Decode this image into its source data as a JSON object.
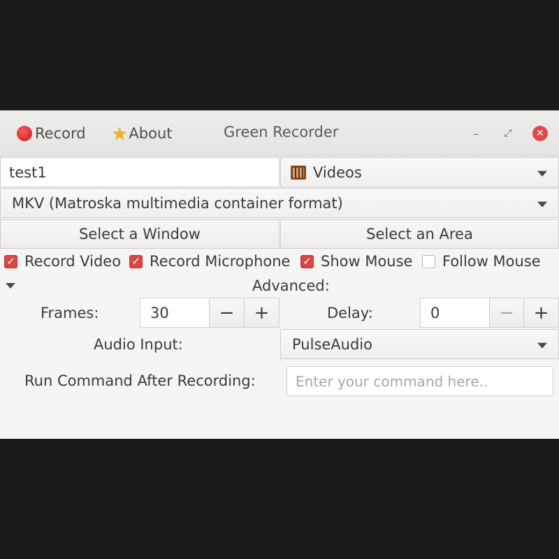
{
  "header": {
    "record_label": "Record",
    "about_label": "About",
    "title": "Green Recorder",
    "minimize": "–",
    "maximize": "⤢",
    "close": "✕"
  },
  "filename": {
    "value": "test1"
  },
  "folder": {
    "selected": "Videos",
    "icon": "folder-icon"
  },
  "format": {
    "selected": "MKV (Matroska multimedia container format)"
  },
  "buttons": {
    "select_window": "Select a Window",
    "select_area": "Select an Area"
  },
  "options": [
    {
      "label": "Record Video",
      "checked": true
    },
    {
      "label": "Record Microphone",
      "checked": true
    },
    {
      "label": "Show Mouse",
      "checked": true
    },
    {
      "label": "Follow Mouse",
      "checked": false
    }
  ],
  "advanced": {
    "label": "Advanced:",
    "frames_label": "Frames:",
    "frames_value": "30",
    "delay_label": "Delay:",
    "delay_value": "0",
    "minus": "−",
    "plus": "+",
    "audio_input_label": "Audio Input:",
    "audio_input_value": "PulseAudio",
    "run_command_label": "Run Command After Recording:",
    "run_command_placeholder": "Enter your command here.."
  },
  "colors": {
    "accent_red": "#d94646",
    "window_bg": "#f5f5f4",
    "screen_bg": "#1b1b1b"
  }
}
